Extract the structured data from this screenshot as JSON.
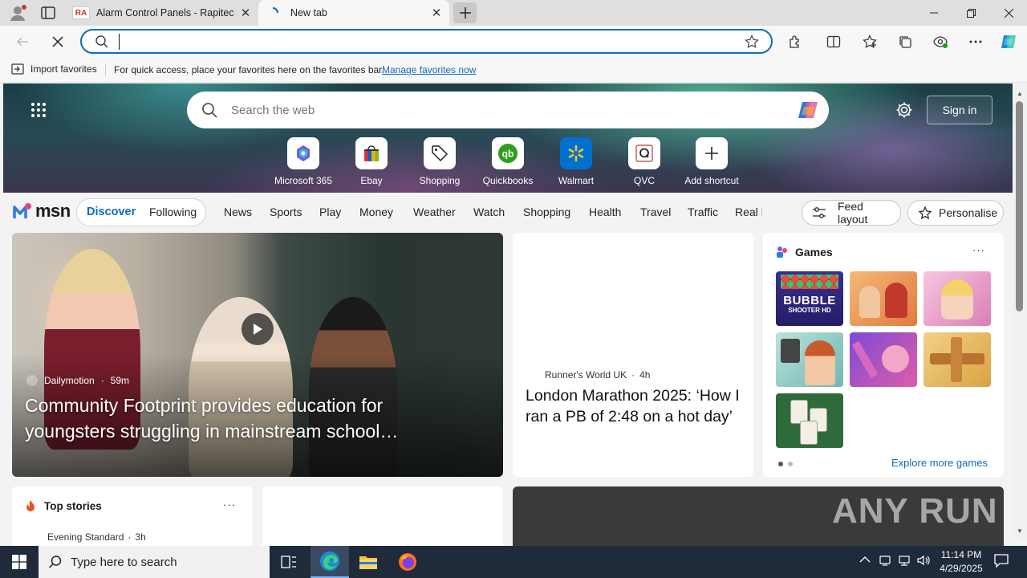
{
  "browser": {
    "tabs": [
      {
        "title": "Alarm Control Panels - Rapitec",
        "favicon": "RA"
      },
      {
        "title": "New tab"
      }
    ],
    "address": {
      "value": "",
      "placeholder": ""
    },
    "favorites_bar": {
      "import_label": "Import favorites",
      "message": "For quick access, place your favorites here on the favorites bar.",
      "manage_link": "Manage favorites now"
    }
  },
  "newtab": {
    "search_placeholder": "Search the web",
    "signin_label": "Sign in",
    "shortcuts": [
      {
        "label": "Microsoft 365",
        "icon": "m365-icon"
      },
      {
        "label": "Ebay",
        "icon": "ebay-icon"
      },
      {
        "label": "Shopping",
        "icon": "tag-icon"
      },
      {
        "label": "Quickbooks",
        "icon": "quickbooks-icon"
      },
      {
        "label": "Walmart",
        "icon": "walmart-icon"
      },
      {
        "label": "QVC",
        "icon": "qvc-icon"
      },
      {
        "label": "Add shortcut",
        "icon": "plus-icon"
      }
    ]
  },
  "msn": {
    "logo": "msn",
    "feed_tabs": [
      "Discover",
      "Following"
    ],
    "nav": [
      "News",
      "Sports",
      "Play",
      "Money",
      "Weather",
      "Watch",
      "Shopping",
      "Health",
      "Travel",
      "Traffic",
      "Real E"
    ],
    "feed_layout_label": "Feed layout",
    "personalise_label": "Personalise"
  },
  "cards": {
    "hero": {
      "source": "Dailymotion",
      "age": "59m",
      "headline": "Community Footprint provides education for youngsters struggling in mainstream school…"
    },
    "story2": {
      "source": "Runner's World UK",
      "age": "4h",
      "headline": "London Marathon 2025: ‘How I ran a PB of 2:48 on a hot day’"
    },
    "games": {
      "title": "Games",
      "explore_label": "Explore more games",
      "tile_text": [
        "BUBBLE",
        "SHOOTER HD"
      ]
    },
    "top_stories": {
      "title": "Top stories",
      "source": "Evening Standard",
      "age": "3h"
    },
    "watermark": {
      "text": "ANY RUN"
    }
  },
  "taskbar": {
    "search_placeholder": "Type here to search",
    "time": "11:14 PM",
    "date": "4/29/2025"
  },
  "colors": {
    "accent": "#0f6cbd",
    "taskbar": "#1f2a3a"
  }
}
